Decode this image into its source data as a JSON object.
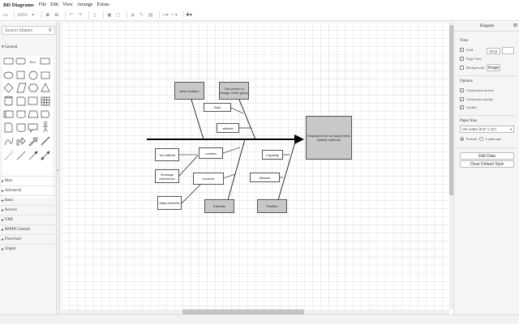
{
  "app": {
    "title": "BD Diagrams"
  },
  "menu": [
    "File",
    "Edit",
    "View",
    "Arrange",
    "Extras"
  ],
  "toolbar": {
    "zoom": "100%"
  },
  "sidebar": {
    "search_placeholder": "Search Shapes",
    "general_label": "General",
    "palettes": [
      "Misc",
      "Advanced",
      "Basic",
      "Arrows",
      "UML",
      "BPMN General",
      "Flowchart",
      "Clipart"
    ]
  },
  "diagram": {
    "effect": "Employees do not apply news (latest) methods",
    "categories": [
      "Work location",
      "The person in charge of the group",
      "Educate",
      "Position"
    ],
    "causes": [
      "Style",
      "attitude",
      "content",
      "Too difficult",
      "Shortage experience",
      "Lectures",
      "Many theories",
      "Capacity",
      "Mission"
    ]
  },
  "format_panel": {
    "tab_label": "Diagram",
    "view_title": "View",
    "grid_label": "Grid",
    "grid_size": "10 pt",
    "page_view_label": "Page View",
    "background_label": "Background",
    "image_button": "Image",
    "options_title": "Options",
    "connection_arrows": "Connection arrows",
    "connection_points": "Connection points",
    "guides": "Guides",
    "paper_size_title": "Paper Size",
    "paper_size_value": "US-Letter (8.5\" x 11\")",
    "portrait_label": "Portrait",
    "landscape_label": "Landscape",
    "edit_data_button": "Edit Data",
    "clear_style_button": "Clear Default Style"
  },
  "colors": {
    "box_fill": "#c8c8c8",
    "line": "#000000",
    "panel_bg": "#f5f5f5"
  }
}
